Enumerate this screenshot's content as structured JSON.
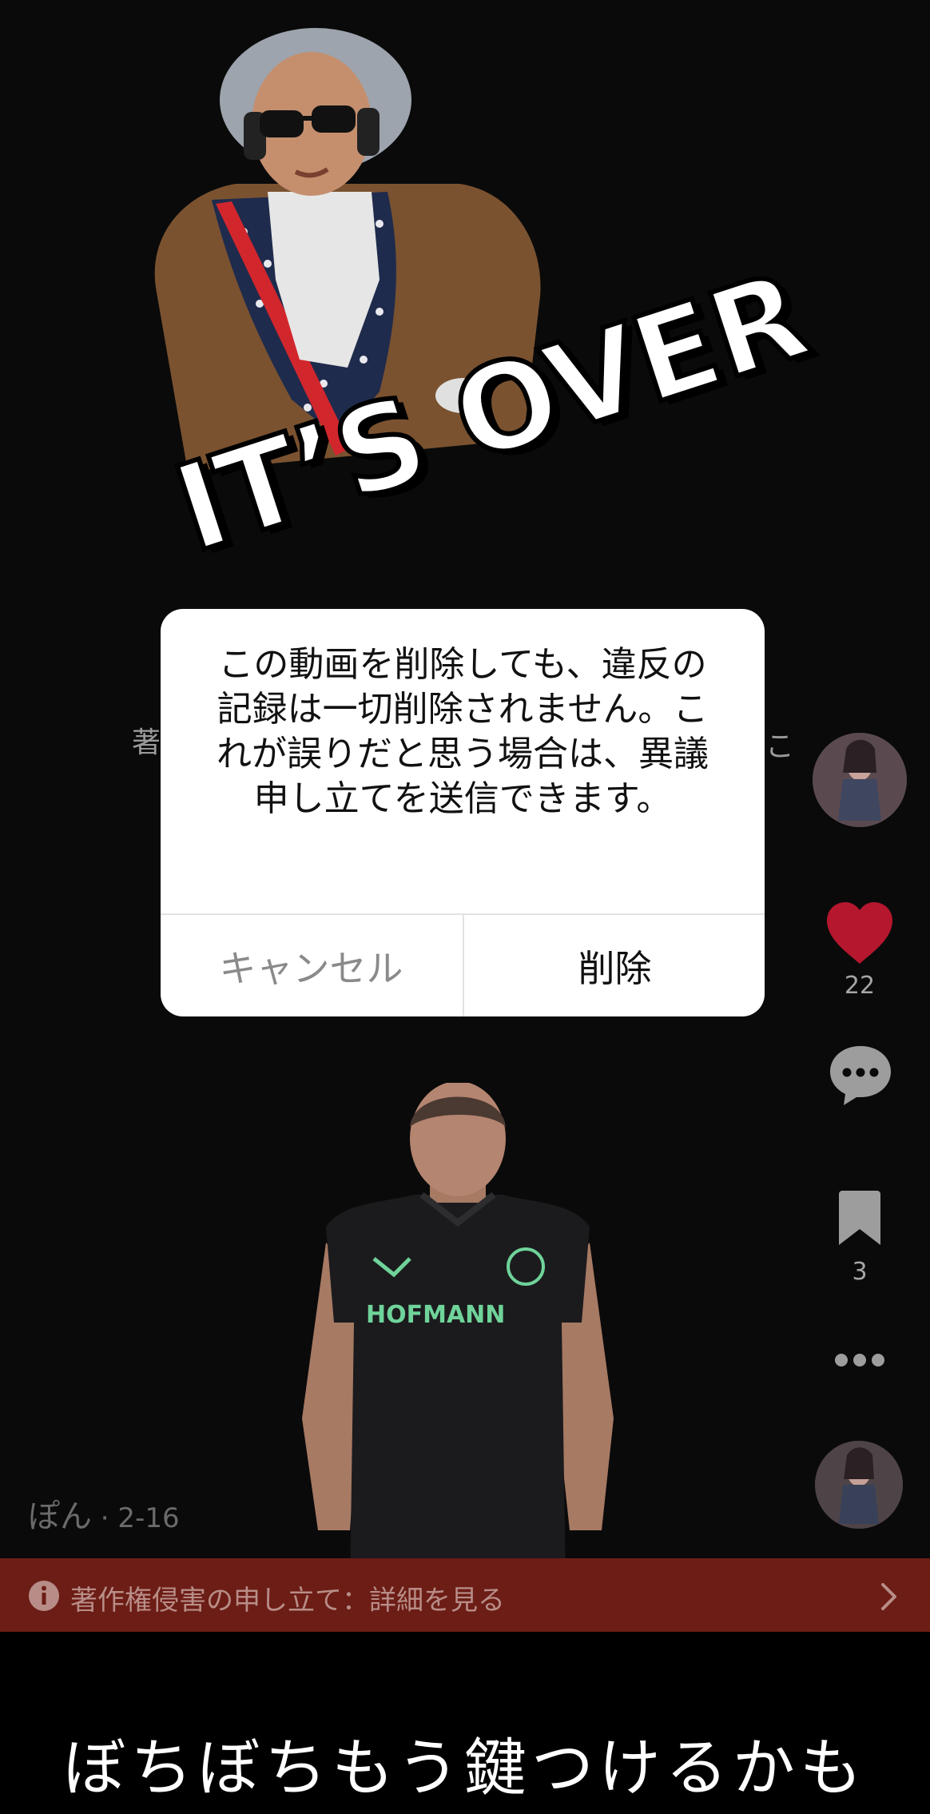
{
  "video": {
    "sticker_top_text": "IT’S OVER",
    "faint_caption_left": "著",
    "faint_caption_right": "こ"
  },
  "actions": {
    "like_count": "22",
    "bookmark_count": "3"
  },
  "author": {
    "name": "ぽん",
    "date": " · 2-16"
  },
  "banner": {
    "text": "著作権侵害の申し立て：詳細を見る"
  },
  "caption": "ぼちぼちもう鍵つけるかも",
  "dialog": {
    "message": "この動画を削除しても、違反の記録は一切削除されません。これが誤りだと思う場合は、異議申し立てを送信できます。",
    "cancel_label": "キャンセル",
    "delete_label": "削除"
  },
  "colors": {
    "like": "#b5172e",
    "banner": "#6c1d16",
    "background": "#0a0a0a"
  },
  "icons": [
    "heart-icon",
    "comment-icon",
    "bookmark-icon",
    "more-icon",
    "info-icon",
    "chevron-right-icon"
  ]
}
